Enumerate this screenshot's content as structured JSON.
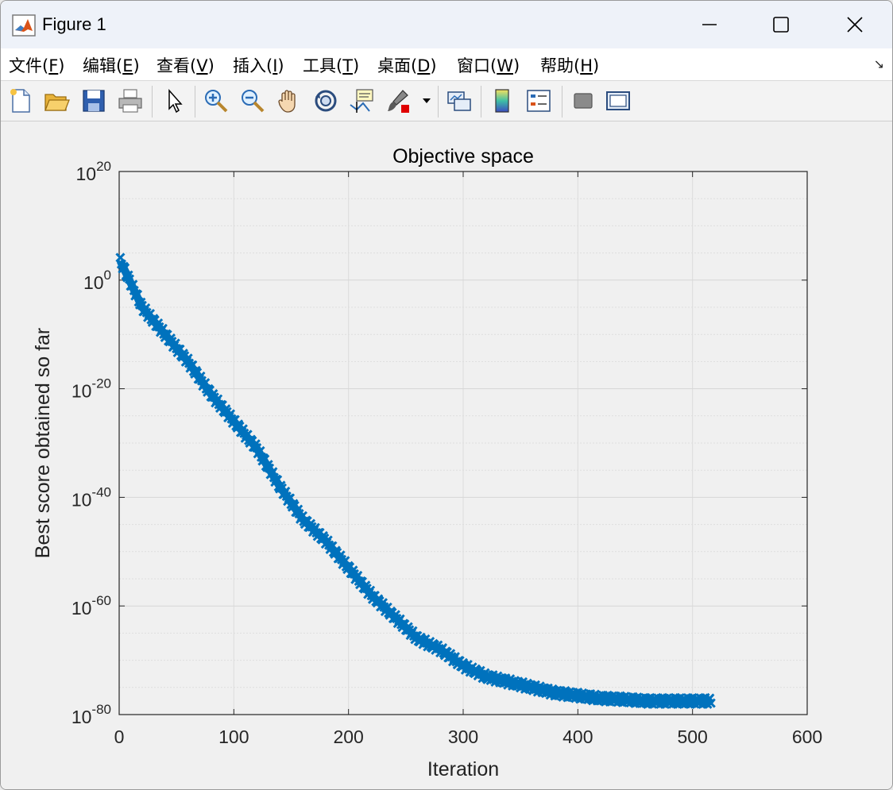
{
  "window": {
    "title": "Figure 1",
    "controls": [
      "minimize",
      "maximize",
      "close"
    ]
  },
  "menu": {
    "items": [
      {
        "pre": "文件(",
        "acc": "F",
        "post": ")"
      },
      {
        "pre": "编辑(",
        "acc": "E",
        "post": ")"
      },
      {
        "pre": "查看(",
        "acc": "V",
        "post": ")"
      },
      {
        "pre": "插入(",
        "acc": "I",
        "post": ")"
      },
      {
        "pre": "工具(",
        "acc": "T",
        "post": ")"
      },
      {
        "pre": "桌面(",
        "acc": "D",
        "post": ")"
      },
      {
        "pre": "窗口(",
        "acc": "W",
        "post": ")"
      },
      {
        "pre": "帮助(",
        "acc": "H",
        "post": ")"
      }
    ],
    "dock_arrow": "↘"
  },
  "toolbar": {
    "icons": [
      "new-figure-icon",
      "open-file-icon",
      "save-icon",
      "print-icon",
      "select-arrow-icon",
      "zoom-in-icon",
      "zoom-out-icon",
      "pan-hand-icon",
      "rotate-3d-icon",
      "data-cursor-icon",
      "brush-icon",
      "link-plot-icon",
      "colorbar-icon",
      "legend-icon",
      "hide-plot-tools-icon",
      "show-plot-tools-icon"
    ]
  },
  "chart_data": {
    "type": "line",
    "title": "Objective space",
    "xlabel": "Iteration",
    "ylabel": "Best score obtained so far",
    "xlim": [
      0,
      600
    ],
    "ylim_exponent": [
      -80,
      20
    ],
    "yscale": "log",
    "xticks": [
      "0",
      "100",
      "200",
      "300",
      "400",
      "500",
      "600"
    ],
    "yticks": [
      {
        "base": "10",
        "exp": "20"
      },
      {
        "base": "10",
        "exp": "0"
      },
      {
        "base": "10",
        "exp": "-20"
      },
      {
        "base": "10",
        "exp": "-40"
      },
      {
        "base": "10",
        "exp": "-60"
      },
      {
        "base": "10",
        "exp": "-80"
      }
    ],
    "grid": true,
    "series": [
      {
        "color": "#0072BD",
        "marker": "x",
        "x_end": 516,
        "points": [
          {
            "x": 0,
            "y": "1e4"
          },
          {
            "x": 20,
            "y": "1e-5"
          },
          {
            "x": 40,
            "y": "1e-10"
          },
          {
            "x": 60,
            "y": "1e-15"
          },
          {
            "x": 80,
            "y": "1e-21"
          },
          {
            "x": 100,
            "y": "1e-26"
          },
          {
            "x": 120,
            "y": "1e-31"
          },
          {
            "x": 140,
            "y": "1e-38"
          },
          {
            "x": 160,
            "y": "1e-44"
          },
          {
            "x": 180,
            "y": "1e-48"
          },
          {
            "x": 200,
            "y": "1e-53"
          },
          {
            "x": 220,
            "y": "1e-58"
          },
          {
            "x": 240,
            "y": "1e-62"
          },
          {
            "x": 260,
            "y": "1e-66"
          },
          {
            "x": 280,
            "y": "1e-68"
          },
          {
            "x": 300,
            "y": "1e-71"
          },
          {
            "x": 320,
            "y": "1e-73"
          },
          {
            "x": 340,
            "y": "1e-74"
          },
          {
            "x": 360,
            "y": "1e-75"
          },
          {
            "x": 380,
            "y": "1e-76"
          },
          {
            "x": 400,
            "y": "1e-76.5"
          },
          {
            "x": 420,
            "y": "1e-77"
          },
          {
            "x": 440,
            "y": "1e-77.2"
          },
          {
            "x": 460,
            "y": "1e-77.5"
          },
          {
            "x": 480,
            "y": "1e-77.5"
          },
          {
            "x": 500,
            "y": "1e-77.5"
          },
          {
            "x": 516,
            "y": "1e-77.5"
          }
        ]
      }
    ]
  }
}
